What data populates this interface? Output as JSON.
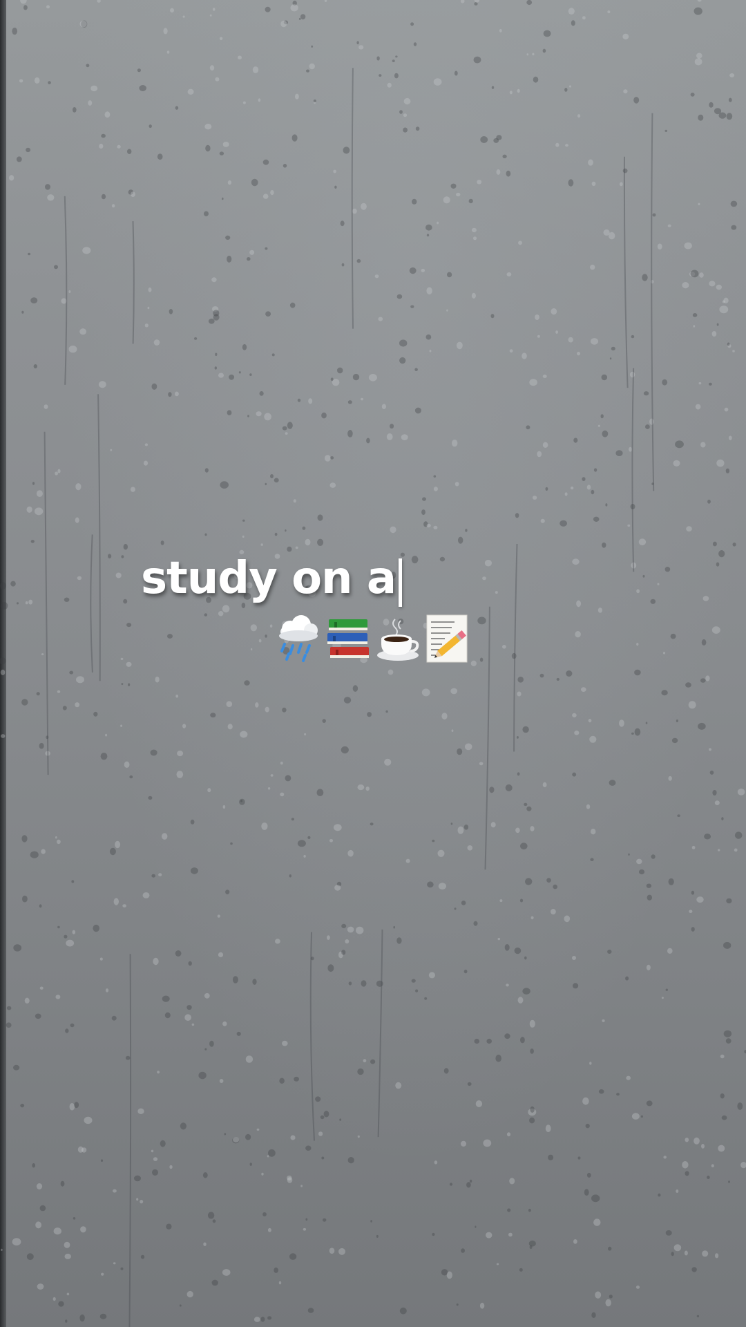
{
  "caption": {
    "text": "study on a"
  },
  "emojis": [
    {
      "icon": "cloud-with-rain-icon"
    },
    {
      "icon": "books-icon"
    },
    {
      "icon": "hot-beverage-icon"
    },
    {
      "icon": "memo-pencil-icon"
    }
  ],
  "colors": {
    "background": "#8a8d90",
    "text": "#ffffff"
  }
}
